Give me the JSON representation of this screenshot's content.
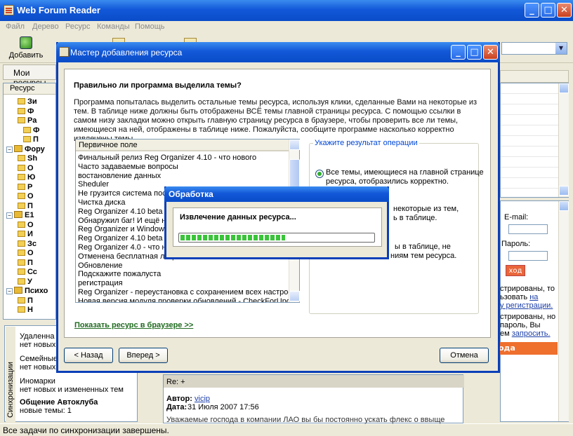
{
  "app": {
    "title": "Web Forum Reader",
    "menu": [
      "Файл",
      "Дерево",
      "Ресурс",
      "Команды",
      "Помощь"
    ],
    "toolbar_add": "Добавить",
    "left_header": "Мои ресурсы",
    "tree_column": "Ресурс",
    "status": "Все задачи по синхронизации завершены."
  },
  "sync": {
    "vertical_label": "Синхронизации",
    "items": [
      {
        "name": "Удаленна",
        "desc": "нет новых и"
      },
      {
        "name": "Семейные",
        "desc": "нет новых и"
      },
      {
        "name": "Иномарки",
        "desc": "нет новых и измененных тем"
      },
      {
        "name": "Общение Автоклуба",
        "desc": "новые темы: 1"
      }
    ]
  },
  "tree": [
    {
      "label": "Зи",
      "indent": 1
    },
    {
      "label": "Ф",
      "indent": 1
    },
    {
      "label": "Ра",
      "indent": 1
    },
    {
      "label": "Ф",
      "indent": 2
    },
    {
      "label": "П",
      "indent": 2
    },
    {
      "label": "Фору",
      "indent": 0
    },
    {
      "label": "Sh",
      "indent": 1
    },
    {
      "label": "О",
      "indent": 1
    },
    {
      "label": "Ю",
      "indent": 1
    },
    {
      "label": "Р",
      "indent": 1
    },
    {
      "label": "О",
      "indent": 1
    },
    {
      "label": "П",
      "indent": 1
    },
    {
      "label": "E1",
      "indent": 0
    },
    {
      "label": "О",
      "indent": 1
    },
    {
      "label": "И",
      "indent": 1
    },
    {
      "label": "Зс",
      "indent": 1
    },
    {
      "label": "О",
      "indent": 1
    },
    {
      "label": "П",
      "indent": 1
    },
    {
      "label": "Сс",
      "indent": 1
    },
    {
      "label": "У",
      "indent": 1
    },
    {
      "label": "Психо",
      "indent": 0
    },
    {
      "label": "П",
      "indent": 1
    },
    {
      "label": "Н",
      "indent": 1
    }
  ],
  "right": {
    "email_label": "E-mail:",
    "password_label": "Пароль:",
    "login_button": "ход",
    "text_lines": [
      "стрированы, то",
      "ьзовать",
      "у регистрации.",
      "стрированы, но",
      "пароль, Вы",
      "ем"
    ],
    "link_na": "на",
    "link_restore": "запросить.",
    "orange_bar": "ода"
  },
  "message": {
    "re": "Re: +",
    "author_label": "Автор:",
    "author": "vicip",
    "date_label": "Дата:",
    "date": "31 Июля 2007 17:56",
    "body": "Уважаемые господа в компании ЛАО вы бы постоянно ускать флекс о ввыще"
  },
  "wizard": {
    "title": "Мастер добавления ресурса",
    "question": "Правильно ли программа выделила темы?",
    "description": "Программа попыталась выделить остальные темы ресурса, используя клики, сделанные Вами на некоторые из тем. В таблице ниже должны быть отображены ВСЁ темы главной страницы ресурса. С помощью ссылки в самом низу закладки можно открыть главную страницу ресурса в браузере, чтобы проверить все ли темы, имеющиеся на ней, отображены в таблице ниже. Пожалуйста, сообщите программе насколько корректно извлечены темы.",
    "column": "Первичное поле",
    "topics": [
      "Финальный релиз Reg Organizer 4.10 - что нового",
      "Часто задаваемые вопросы",
      "востановление данных",
      "Sheduler",
      "Не грузится система после С",
      "Чистка диска",
      "Reg Organizer 4.10 beta 3 -",
      "Обнаружил баг! И ещё неск",
      "Reg Organizer и Windows Vi",
      "Reg Organizer 4.10 beta 2 -",
      "Reg Organizer 4.0 - что нов",
      "Отменена бесплатная лицен",
      "Обновление",
      "Подскажите  пожалуста",
      "регистрация",
      "Reg Organizer - переустановка с сохранением всех настроек",
      "Новая версия модуля проверки обновлений - CheckForUpdate 2.0"
    ],
    "result_legend": "Укажите результат операции",
    "option1": [
      "Все темы, имеющиеся на главной странице",
      "ресурса, отобразились корректно."
    ],
    "option2": [
      "некоторые из тем,",
      "ь в таблице."
    ],
    "option3": [
      "ы в таблице, не",
      "ниям тем ресурса."
    ],
    "show_link": "Показать ресурс в браузере >>",
    "back": "< Назад",
    "next": "Вперед >",
    "cancel": "Отмена"
  },
  "processing": {
    "title": "Обработка",
    "label": "Извлечение данных ресурса...",
    "progress": 0.54
  }
}
